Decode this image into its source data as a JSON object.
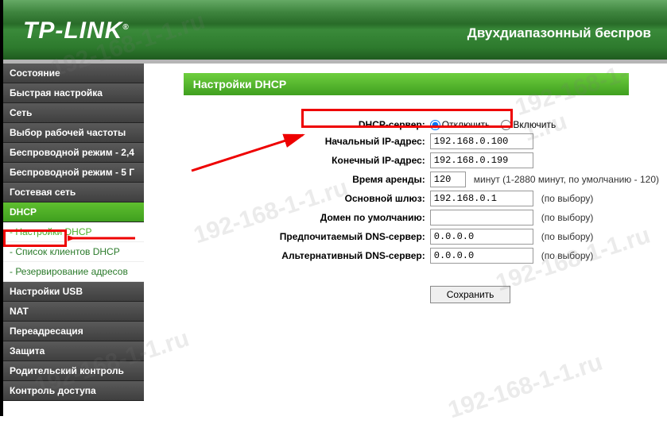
{
  "header": {
    "logo": "TP-LINK",
    "reg": "®",
    "tagline": "Двухдиапазонный беспров"
  },
  "sidebar": {
    "items": [
      {
        "label": "Состояние"
      },
      {
        "label": "Быстрая настройка"
      },
      {
        "label": "Сеть"
      },
      {
        "label": "Выбор рабочей частоты"
      },
      {
        "label": "Беспроводной режим - 2,4"
      },
      {
        "label": "Беспроводной режим - 5 Г"
      },
      {
        "label": "Гостевая сеть"
      },
      {
        "label": "DHCP",
        "active": true
      },
      {
        "label": "Настройки USB"
      },
      {
        "label": "NAT"
      },
      {
        "label": "Переадресация"
      },
      {
        "label": "Защита"
      },
      {
        "label": "Родительский контроль"
      },
      {
        "label": "Контроль доступа"
      }
    ],
    "dhcp_sub": [
      {
        "label": "- Настройки DHCP",
        "current": true
      },
      {
        "label": "- Список клиентов DHCP"
      },
      {
        "label": "- Резервирование адресов"
      }
    ]
  },
  "panel": {
    "title": "Настройки DHCP",
    "rows": {
      "dhcp_server_label": "DHCP-сервер:",
      "disable": "Отключить",
      "enable": "Включить",
      "start_ip_label": "Начальный IP-адрес:",
      "start_ip": "192.168.0.100",
      "end_ip_label": "Конечный IP-адрес:",
      "end_ip": "192.168.0.199",
      "lease_label": "Время аренды:",
      "lease_val": "120",
      "lease_hint": "минут (1-2880 минут, по умолчанию - 120)",
      "gateway_label": "Основной шлюз:",
      "gateway": "192.168.0.1",
      "domain_label": "Домен по умолчанию:",
      "domain": "",
      "dns1_label": "Предпочитаемый DNS-сервер:",
      "dns1": "0.0.0.0",
      "dns2_label": "Альтернативный DNS-сервер:",
      "dns2": "0.0.0.0",
      "optional": "(по выбору)"
    },
    "save": "Сохранить"
  },
  "watermark": "192-168-1-1.ru"
}
